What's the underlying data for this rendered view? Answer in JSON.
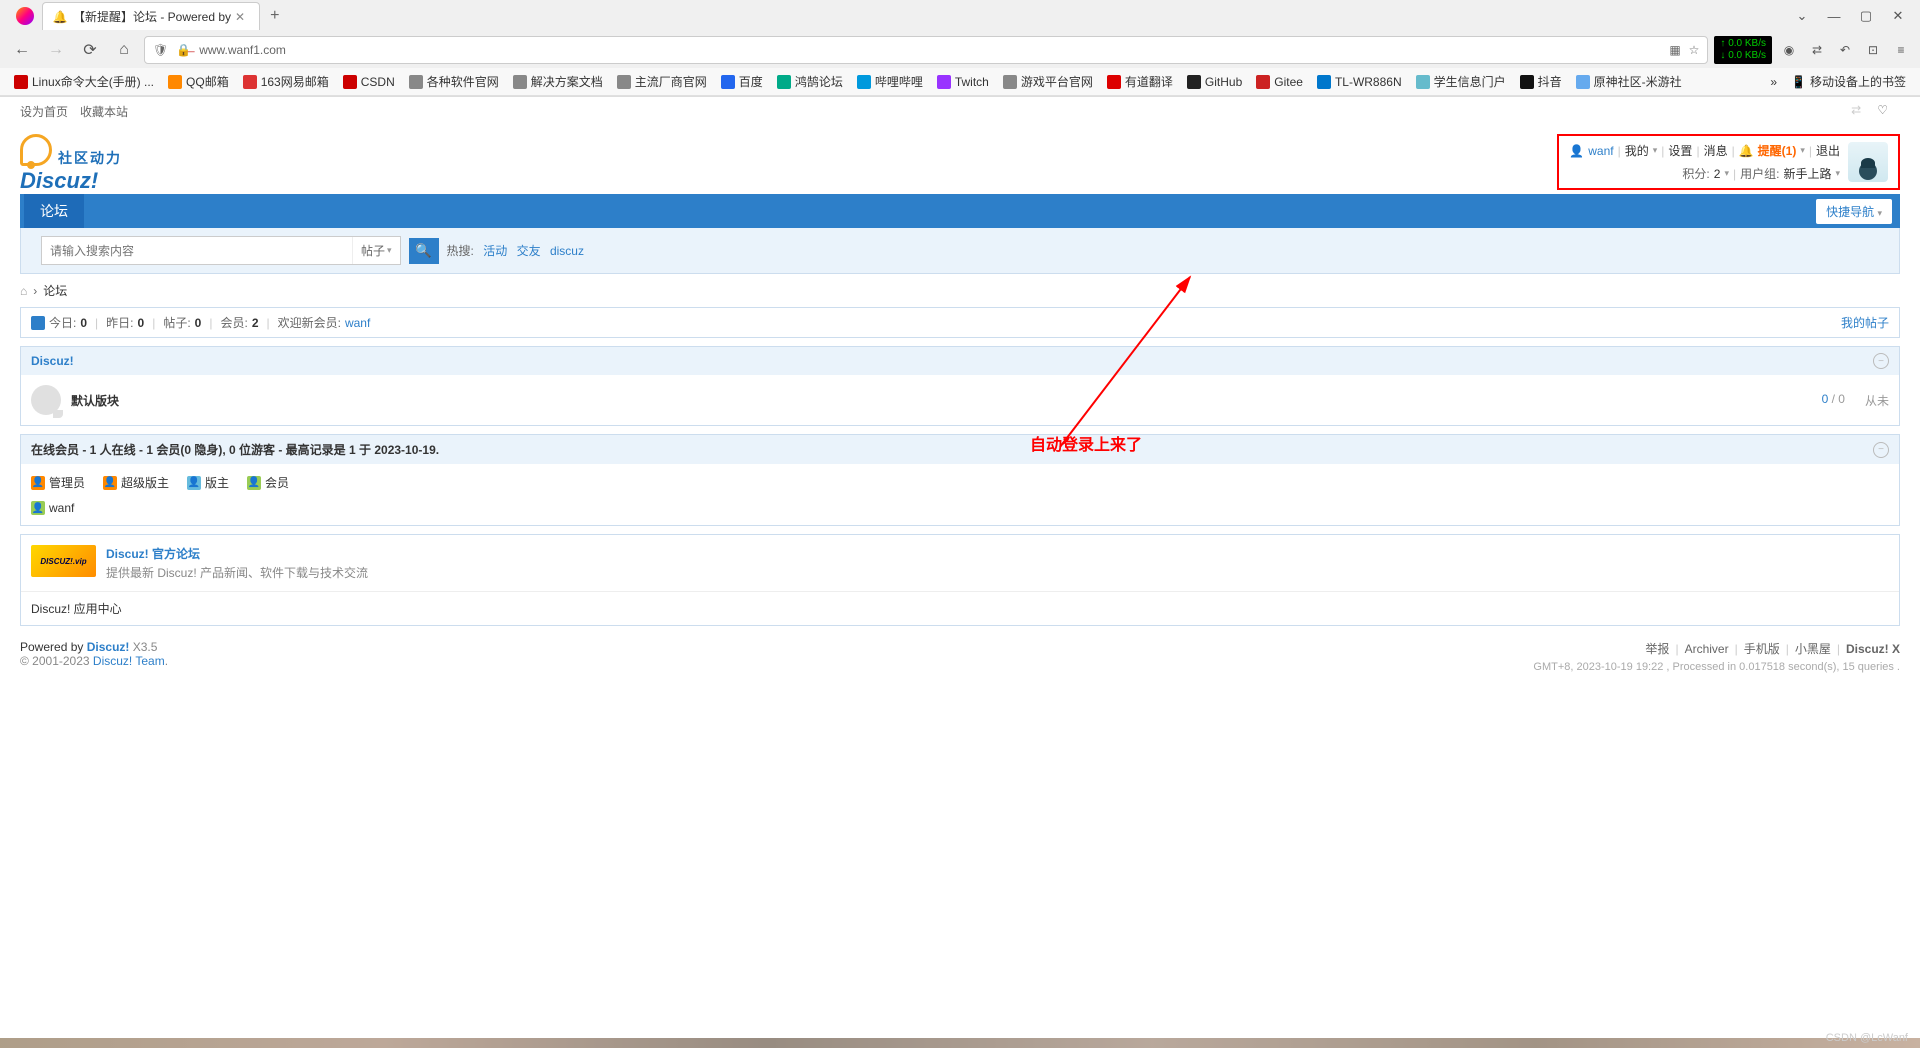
{
  "browser": {
    "tab_title": "【新提醒】论坛 - Powered by",
    "url": "www.wanf1.com",
    "net_up": "↑ 0.0 KB/s",
    "net_down": "↓ 0.0 KB/s",
    "win": {
      "min": "—",
      "max": "▢",
      "close": "✕",
      "dropdown": "⌄"
    }
  },
  "bookmarks": [
    {
      "label": "Linux命令大全(手册) ...",
      "color": "#c00"
    },
    {
      "label": "QQ邮箱",
      "color": "#f80"
    },
    {
      "label": "163网易邮箱",
      "color": "#d33"
    },
    {
      "label": "CSDN",
      "color": "#c00"
    },
    {
      "label": "各种软件官网",
      "color": "#888"
    },
    {
      "label": "解决方案文档",
      "color": "#888"
    },
    {
      "label": "主流厂商官网",
      "color": "#888"
    },
    {
      "label": "百度",
      "color": "#26e"
    },
    {
      "label": "鸿鹄论坛",
      "color": "#0a8"
    },
    {
      "label": "哔哩哔哩",
      "color": "#09d"
    },
    {
      "label": "Twitch",
      "color": "#93f"
    },
    {
      "label": "游戏平台官网",
      "color": "#888"
    },
    {
      "label": "有道翻译",
      "color": "#d00"
    },
    {
      "label": "GitHub",
      "color": "#222"
    },
    {
      "label": "Gitee",
      "color": "#c22"
    },
    {
      "label": "TL-WR886N",
      "color": "#07c"
    },
    {
      "label": "学生信息门户",
      "color": "#6bc"
    },
    {
      "label": "抖音",
      "color": "#111"
    },
    {
      "label": "原神社区-米游社",
      "color": "#6ae"
    }
  ],
  "bookmark_more": "»",
  "mobile_bookmarks": "移动设备上的书签",
  "topbar": {
    "set_home": "设为首页",
    "fav": "收藏本站"
  },
  "logo": {
    "cn": "社区动力",
    "en": "Discuz!"
  },
  "user": {
    "name": "wanf",
    "mine": "我的",
    "settings": "设置",
    "msg": "消息",
    "notify": "提醒(1)",
    "logout": "退出",
    "points_label": "积分:",
    "points": "2",
    "group_label": "用户组:",
    "group": "新手上路"
  },
  "nav": {
    "forum": "论坛",
    "quick": "快捷导航"
  },
  "search": {
    "placeholder": "请输入搜索内容",
    "type": "帖子",
    "hot_label": "热搜:",
    "hot": [
      "活动",
      "交友",
      "discuz"
    ]
  },
  "crumb": {
    "forum": "论坛"
  },
  "stats": {
    "today_l": "今日:",
    "today": "0",
    "yesterday_l": "昨日:",
    "yesterday": "0",
    "posts_l": "帖子:",
    "posts": "0",
    "members_l": "会员:",
    "members": "2",
    "welcome": "欢迎新会员:",
    "new_member": "wanf",
    "my_posts": "我的帖子"
  },
  "section1": {
    "title": "Discuz!",
    "forum": "默认版块",
    "count1": "0",
    "count2": "0",
    "last": "从未"
  },
  "online": {
    "title": "在线会员 - 1 人在线 - 1 会员(0 隐身), 0 位游客 - 最高记录是 1 于 2023-10-19.",
    "legend": [
      {
        "label": "管理员",
        "color": "#f80"
      },
      {
        "label": "超级版主",
        "color": "#f80"
      },
      {
        "label": "版主",
        "color": "#6bd"
      },
      {
        "label": "会员",
        "color": "#9c5"
      }
    ],
    "user": "wanf"
  },
  "promo": {
    "img_text": "DISCUZ!.vip",
    "title": "Discuz! 官方论坛",
    "desc": "提供最新 Discuz! 产品新闻、软件下载与技术交流",
    "app_center": "Discuz! 应用中心"
  },
  "footer": {
    "powered": "Powered by",
    "dz": "Discuz!",
    "ver": "X3.5",
    "copy": "© 2001-2023",
    "team": "Discuz! Team",
    "links": [
      "举报",
      "Archiver",
      "手机版",
      "小黑屋",
      "Discuz! X"
    ],
    "time": "GMT+8, 2023-10-19 19:22 , Processed in 0.017518 second(s), 15 queries ."
  },
  "annotation": "自动登录上来了",
  "watermark": "CSDN @LcWanf"
}
